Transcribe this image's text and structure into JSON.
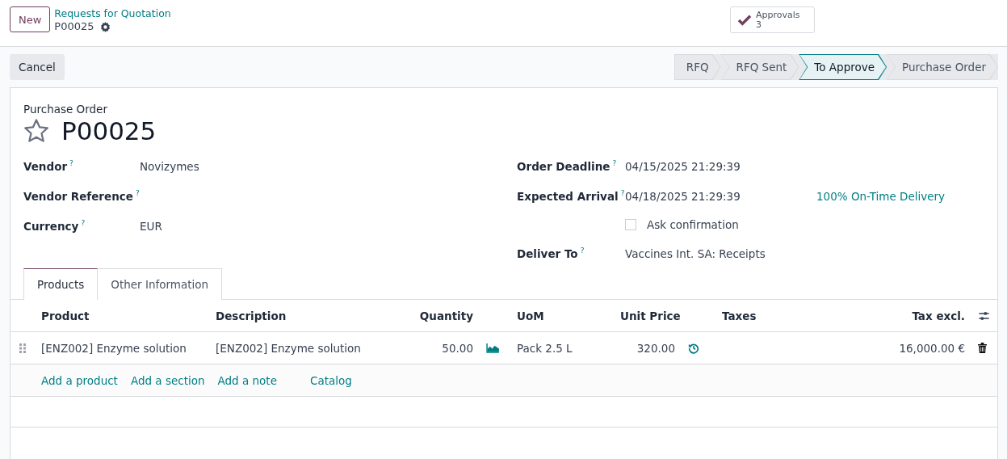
{
  "top_bar": {
    "new_button": "New",
    "breadcrumb": "Requests for Quotation",
    "record": "P00025",
    "smart_button": {
      "label": "Approvals",
      "count": "3"
    }
  },
  "actions": {
    "cancel_button": "Cancel"
  },
  "status_stages": [
    {
      "label": "RFQ",
      "selected": false
    },
    {
      "label": "RFQ Sent",
      "selected": false
    },
    {
      "label": "To Approve",
      "selected": true
    },
    {
      "label": "Purchase Order",
      "selected": false
    }
  ],
  "form": {
    "type_label": "Purchase Order",
    "name": "P00025",
    "starred": false,
    "left_fields": [
      {
        "label": "Vendor",
        "help": "?",
        "value": "Novizymes"
      },
      {
        "label": "Vendor Reference",
        "help": "?"
      },
      {
        "label": "Currency",
        "help": "?",
        "value": "EUR"
      }
    ],
    "right_fields": [
      {
        "kind": "text",
        "label": "Order Deadline",
        "help": "?",
        "value": "04/15/2025 21:29:39"
      },
      {
        "kind": "text",
        "label": "Expected Arrival",
        "help": "?",
        "value": "04/18/2025 21:29:39",
        "extra": "100% On-Time Delivery"
      },
      {
        "kind": "checkbox",
        "label": "Ask confirmation",
        "checked": false
      },
      {
        "kind": "text",
        "label": "Deliver To",
        "help": "?",
        "value": "Vaccines Int. SA: Receipts"
      }
    ]
  },
  "tabs": [
    {
      "label": "Products",
      "selected": true
    },
    {
      "label": "Other Information",
      "selected": false
    }
  ],
  "table": {
    "columns": [
      "Product",
      "Description",
      "Quantity",
      "UoM",
      "Unit Price",
      "Taxes",
      "Tax excl."
    ],
    "rows": [
      {
        "product": "[ENZ002] Enzyme solution",
        "description": "[ENZ002] Enzyme solution",
        "quantity": "50.00",
        "uom": "Pack 2.5 L",
        "unit_price": "320.00",
        "tax_excl": "16,000.00 €"
      }
    ],
    "add_links": [
      "Add a product",
      "Add a section",
      "Add a note",
      "Catalog"
    ]
  }
}
